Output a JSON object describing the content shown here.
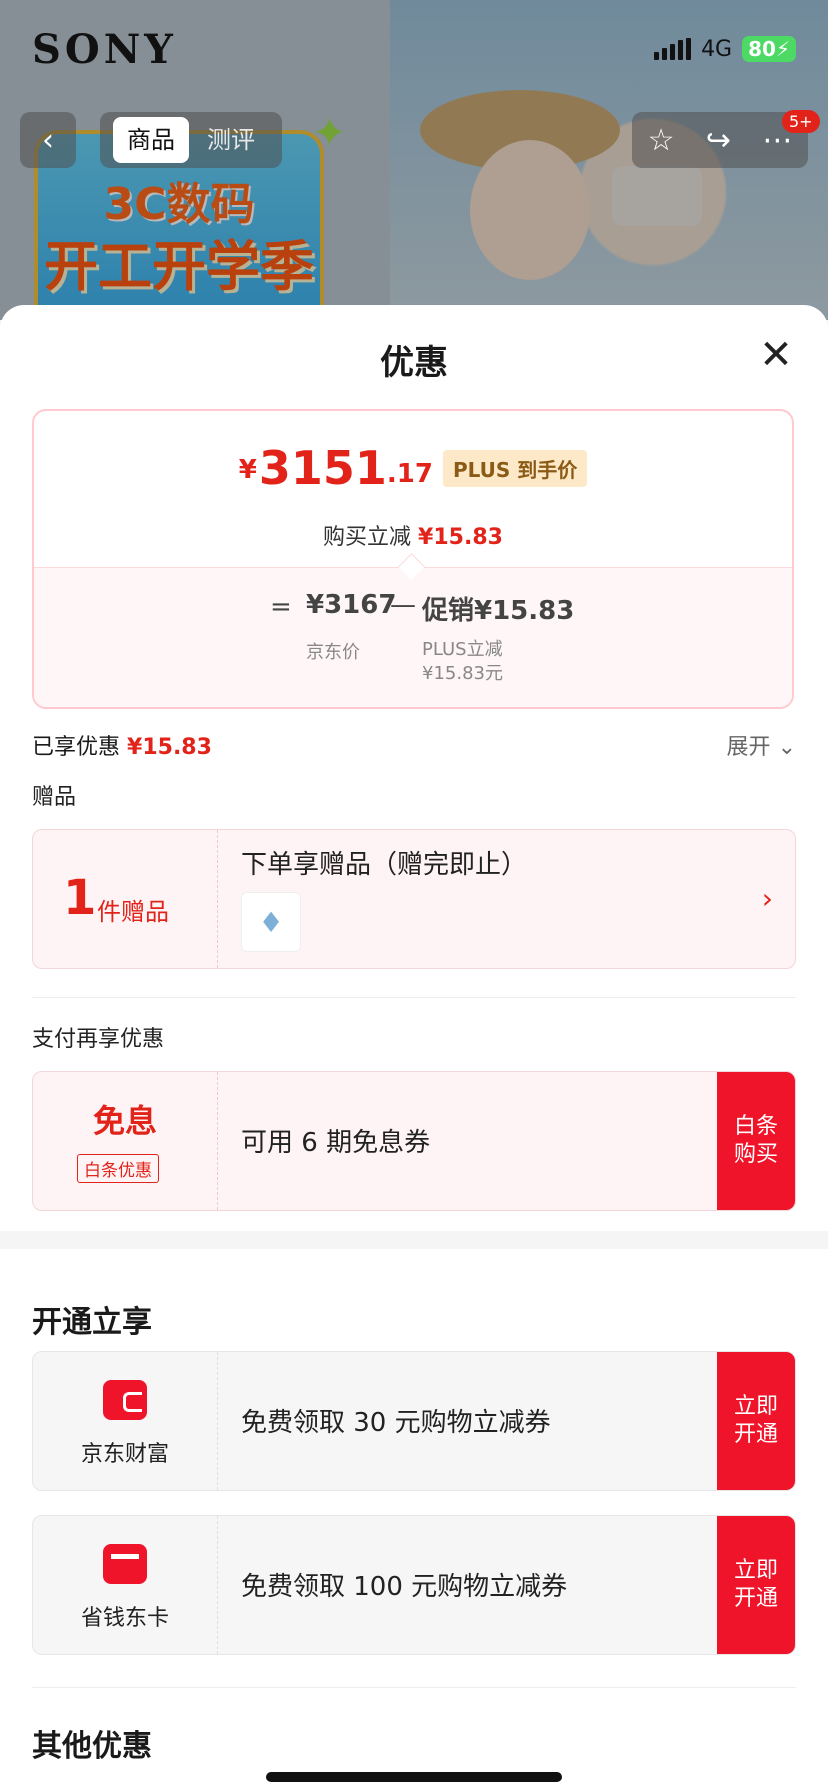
{
  "status_bar": {
    "signal": "4G",
    "battery": "80"
  },
  "background": {
    "brand": "SONY",
    "promo_line1": "3C数码",
    "promo_line2": "开工开学季"
  },
  "top_bar": {
    "tabs": [
      "商品",
      "测评"
    ],
    "cart_badge": "5+"
  },
  "sheet": {
    "title": "优惠",
    "price": {
      "currency": "¥",
      "integer": "3151",
      "decimal": ".17",
      "tag": "PLUS 到手价",
      "reduce_label": "购买立减",
      "reduce_amount": "¥15.83",
      "equals": "=",
      "jd_price": "¥3167",
      "jd_label": "京东价",
      "minus": "—",
      "promo": "促销¥15.83",
      "plus_cut": "PLUS立减 ¥15.83元"
    },
    "enjoyed": {
      "label": "已享优惠",
      "amount": "¥15.83",
      "expand": "展开"
    },
    "gift": {
      "section": "赠品",
      "count": "1",
      "unit": "件赠品",
      "title": "下单享赠品（赠完即止）"
    },
    "pay": {
      "section": "支付再享优惠",
      "title": "免息",
      "tag": "白条优惠",
      "desc": "可用 6 期免息券",
      "button": "白条\n购买"
    },
    "open": {
      "section": "开通立享",
      "items": [
        {
          "name": "京东财富",
          "desc": "免费领取 30 元购物立减券",
          "button": "立即\n开通",
          "icon": "wallet-icon"
        },
        {
          "name": "省钱东卡",
          "desc": "免费领取 100 元购物立减券",
          "button": "立即\n开通",
          "icon": "card-icon"
        }
      ]
    },
    "other": {
      "section": "其他优惠"
    }
  },
  "colors": {
    "accent": "#e2231a",
    "button": "#f0142a",
    "tag_bg": "#fde9c8"
  }
}
